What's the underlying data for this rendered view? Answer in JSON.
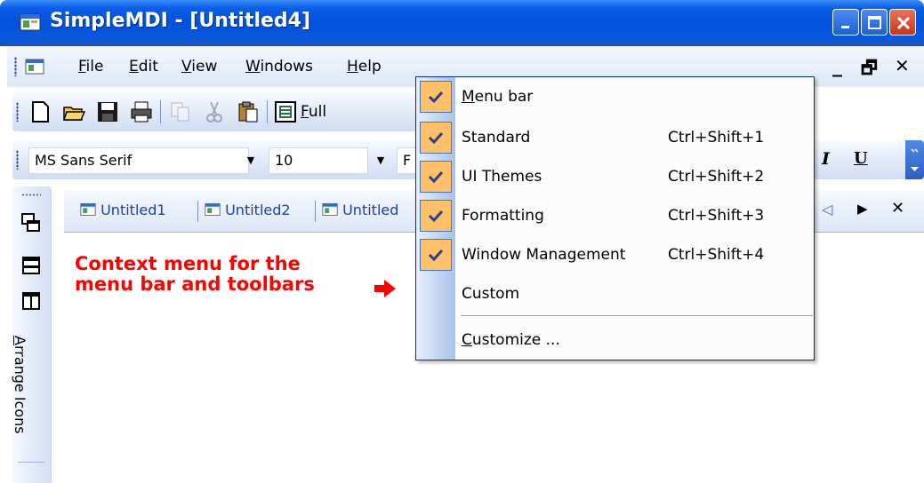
{
  "window": {
    "title": "SimpleMDI - [Untitled4]"
  },
  "menubar": {
    "items": [
      {
        "label": "File",
        "accel": "F",
        "rest": "ile"
      },
      {
        "label": "Edit",
        "accel": "E",
        "rest": "dit"
      },
      {
        "label": "View",
        "accel": "V",
        "rest": "iew"
      },
      {
        "label": "Windows",
        "accel": "W",
        "rest": "indows"
      },
      {
        "label": "Help",
        "accel": "H",
        "rest": "elp"
      }
    ],
    "mdi_controls": {
      "minimize": "_",
      "restore": "🗗",
      "close": "✕"
    }
  },
  "standard_toolbar": {
    "icons": [
      "new-icon",
      "open-icon",
      "save-icon",
      "print-icon",
      "copy-icon",
      "cut-icon",
      "paste-icon",
      "full-screen-icon"
    ],
    "full_screen_label_accel": "F",
    "full_screen_label_rest": "ull"
  },
  "formatting_toolbar": {
    "font_name": "MS Sans Serif",
    "font_size": "10",
    "font_combo_partial": "F",
    "italic_label": "I",
    "underline_label": "U"
  },
  "vertical_toolbar": {
    "label_accel": "A",
    "label_rest": "rrange Icons",
    "icons": [
      "cascade-icon",
      "tile-horizontal-icon",
      "tile-vertical-icon"
    ]
  },
  "mdi_tabs": {
    "tabs": [
      "Untitled1",
      "Untitled2",
      "Untitled"
    ],
    "nav": {
      "prev": "◁",
      "next": "▶",
      "close": "✕"
    }
  },
  "annotation": {
    "line1": "Context menu for the",
    "line2": "menu bar and toolbars"
  },
  "context_menu": {
    "items": [
      {
        "label_accel": "M",
        "label_rest": "enu bar",
        "shortcut": "",
        "checked": true
      },
      {
        "label_accel": "",
        "label_rest": "Standard",
        "shortcut": "Ctrl+Shift+1",
        "checked": true
      },
      {
        "label_accel": "",
        "label_rest": "UI Themes",
        "shortcut": "Ctrl+Shift+2",
        "checked": true
      },
      {
        "label_accel": "",
        "label_rest": "Formatting",
        "shortcut": "Ctrl+Shift+3",
        "checked": true
      },
      {
        "label_accel": "",
        "label_rest": "Window Management",
        "shortcut": "Ctrl+Shift+4",
        "checked": true
      },
      {
        "label_accel": "",
        "label_rest": "Custom",
        "shortcut": "",
        "checked": false
      }
    ],
    "customize_accel": "C",
    "customize_rest": "ustomize ..."
  },
  "colors": {
    "titlebar": "#0352d9",
    "check_bg": "#ffc06a",
    "annotation": "#ff0000",
    "tab_text": "#1c3fae"
  }
}
